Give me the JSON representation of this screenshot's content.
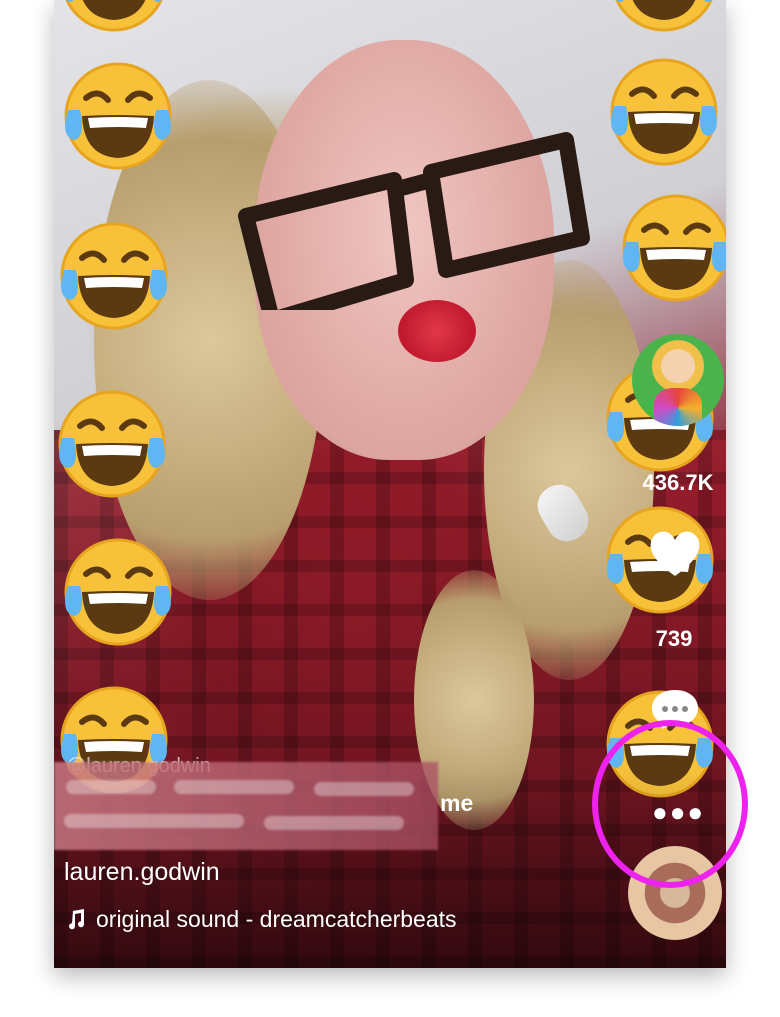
{
  "video": {
    "watermark_handle": "@lauren.godwin",
    "caption_partial": "me",
    "username": "lauren.godwin",
    "sound": "original sound - dreamcatcherbeats"
  },
  "actions": {
    "like_count": "436.7K",
    "comment_count": "739",
    "share_icon": "more-dots-icon",
    "like_icon": "heart-icon",
    "comment_icon": "comment-bubble-icon"
  },
  "overlay": {
    "emoji": "face-with-tears-of-joy",
    "highlight_color": "#ee22ee"
  }
}
